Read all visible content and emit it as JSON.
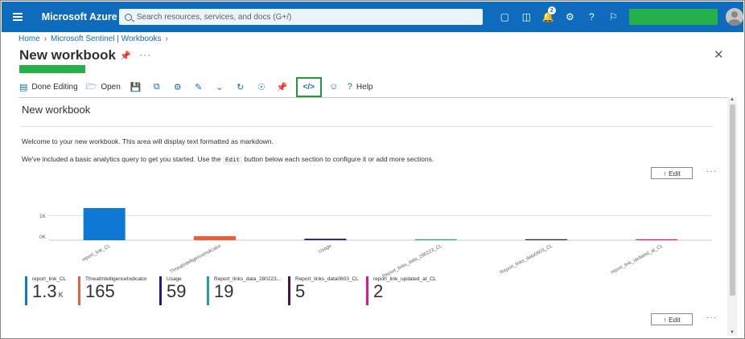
{
  "topbar": {
    "brand": "Microsoft Azure",
    "search_placeholder": "Search resources, services, and docs (G+/)",
    "notification_count": "2",
    "brand_color": "#0f6cbd"
  },
  "breadcrumb": [
    "Home",
    "Microsoft Sentinel | Workbooks"
  ],
  "page": {
    "title": "New workbook"
  },
  "toolbar": {
    "done_editing": "Done Editing",
    "open": "Open",
    "help": "Help"
  },
  "panel": {
    "title": "New workbook",
    "welcome_text": "Welcome to your new workbook. This area will display text formatted as markdown.",
    "intro_before": "We've included a basic analytics query to get you started. Use the",
    "intro_code": "Edit",
    "intro_after": "button below each section to configure it or add more sections.",
    "edit_label": "↑ Edit",
    "more_label": "···"
  },
  "chart_data": {
    "type": "bar",
    "categories": [
      "report_link_CL",
      "ThreatIntelligenceIndicator",
      "Usage",
      "Report_links_data_280223_CL",
      "Report_links_data0603_CL",
      "report_link_updated_at_CL"
    ],
    "values": [
      1300,
      165,
      59,
      19,
      5,
      2
    ],
    "colors": [
      "#0f78d4",
      "#e8603c",
      "#1b1b8a",
      "#21a1a1",
      "#4b1248",
      "#e3158a"
    ],
    "yticks": [
      "1K",
      "0K"
    ],
    "ylim": [
      0,
      1300
    ]
  },
  "kpis": [
    {
      "label": "report_link_CL",
      "value": "1.3",
      "unit": "K",
      "color": "#0f78d4"
    },
    {
      "label": "ThreatIntelligenceIndicator",
      "value": "165",
      "unit": "",
      "color": "#e8603c"
    },
    {
      "label": "Usage",
      "value": "59",
      "unit": "",
      "color": "#1b1b8a"
    },
    {
      "label": "Report_links_data_280223...",
      "value": "19",
      "unit": "",
      "color": "#21a1a1"
    },
    {
      "label": "Report_links_data0603_CL",
      "value": "5",
      "unit": "",
      "color": "#4b1248"
    },
    {
      "label": "report_link_updated_at_CL",
      "value": "2",
      "unit": "",
      "color": "#e3158a"
    }
  ]
}
